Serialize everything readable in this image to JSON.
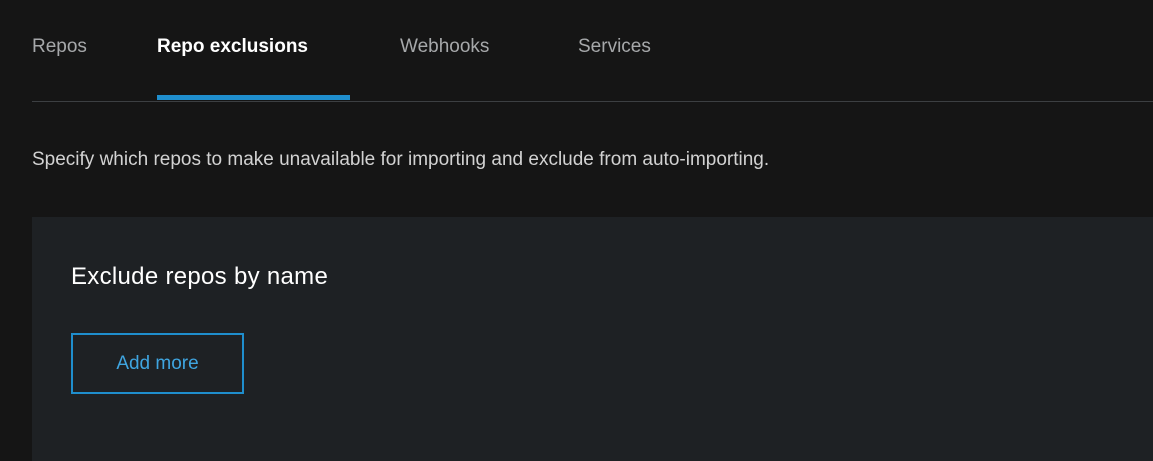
{
  "tabs": [
    {
      "label": "Repos",
      "active": false
    },
    {
      "label": "Repo exclusions",
      "active": true
    },
    {
      "label": "Webhooks",
      "active": false
    },
    {
      "label": "Services",
      "active": false
    }
  ],
  "description": "Specify which repos to make unavailable for importing and exclude from auto-importing.",
  "exclusion_panel": {
    "title": "Exclude repos by name",
    "add_more_label": "Add more"
  },
  "colors": {
    "background": "#151515",
    "panel": "#1e2124",
    "accent": "#1f8ecd",
    "active_tab_text": "#ffffff",
    "inactive_tab_text": "#a6a8aa"
  }
}
